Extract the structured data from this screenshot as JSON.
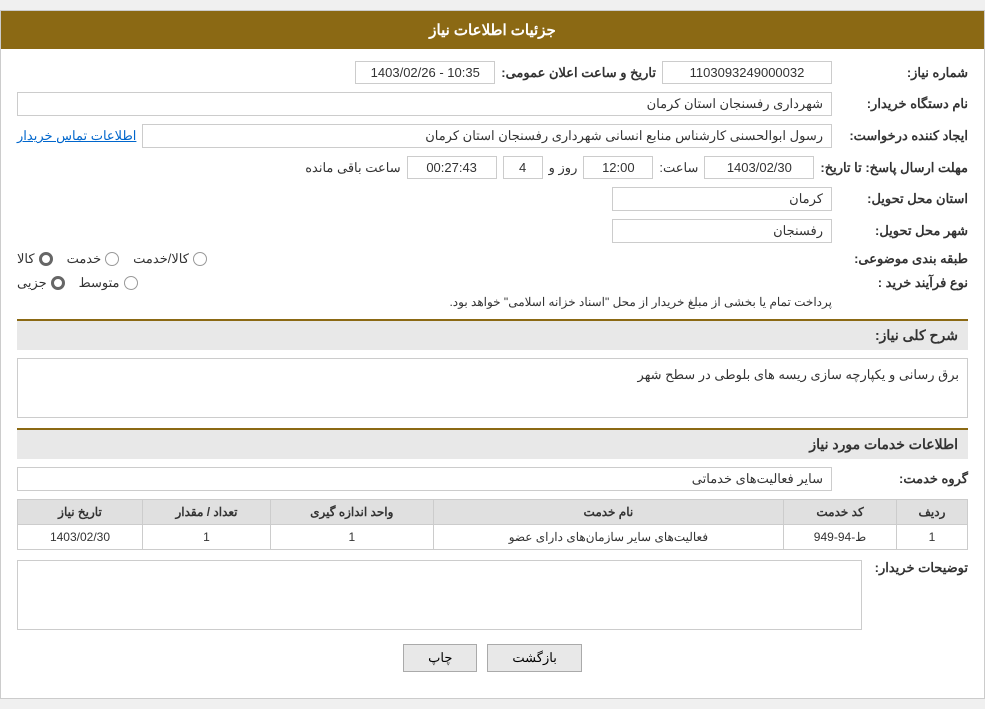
{
  "header": {
    "title": "جزئیات اطلاعات نیاز"
  },
  "fields": {
    "need_number_label": "شماره نیاز:",
    "need_number_value": "1103093249000032",
    "announce_date_label": "تاریخ و ساعت اعلان عمومی:",
    "announce_date_value": "1403/02/26 - 10:35",
    "org_name_label": "نام دستگاه خریدار:",
    "org_name_value": "شهرداری رفسنجان استان کرمان",
    "creator_label": "ایجاد کننده درخواست:",
    "creator_value": "رسول ابوالحسنی کارشناس منابع انسانی شهرداری رفسنجان استان کرمان",
    "contact_info_link": "اطلاعات تماس خریدار",
    "response_deadline_label": "مهلت ارسال پاسخ: تا تاریخ:",
    "response_date_value": "1403/02/30",
    "response_time_label": "ساعت:",
    "response_time_value": "12:00",
    "response_days_label": "روز و",
    "response_days_value": "4",
    "remaining_label": "ساعت باقی مانده",
    "remaining_time_value": "00:27:43",
    "province_label": "استان محل تحویل:",
    "province_value": "کرمان",
    "city_label": "شهر محل تحویل:",
    "city_value": "رفسنجان",
    "category_label": "طبقه بندی موضوعی:",
    "category_options": [
      {
        "label": "کالا",
        "selected": false
      },
      {
        "label": "خدمت",
        "selected": true
      },
      {
        "label": "کالا/خدمت",
        "selected": false
      }
    ],
    "purchase_type_label": "نوع فرآیند خرید :",
    "purchase_type_options": [
      {
        "label": "جزیی",
        "selected": false
      },
      {
        "label": "متوسط",
        "selected": true
      },
      {
        "label": "",
        "selected": false
      }
    ],
    "purchase_type_note": "پرداخت تمام یا بخشی از مبلغ خریدار از محل \"اسناد خزانه اسلامی\" خواهد بود.",
    "need_description_label": "شرح کلی نیاز:",
    "need_description_value": "برق رسانی و یکپارچه سازی ریسه های بلوطی در سطح شهر",
    "services_section_label": "اطلاعات خدمات مورد نیاز",
    "service_group_label": "گروه خدمت:",
    "service_group_value": "سایر فعالیت‌های خدماتی",
    "table": {
      "headers": [
        "ردیف",
        "کد خدمت",
        "نام خدمت",
        "واحد اندازه گیری",
        "تعداد / مقدار",
        "تاریخ نیاز"
      ],
      "rows": [
        {
          "row": "1",
          "code": "ط-94-949",
          "name": "فعالیت‌های سایر سازمان‌های دارای عضو",
          "unit": "1",
          "quantity": "1",
          "date": "1403/02/30"
        }
      ]
    },
    "buyer_desc_label": "توضیحات خریدار:",
    "buyer_desc_value": ""
  },
  "buttons": {
    "print_label": "چاپ",
    "back_label": "بازگشت"
  }
}
